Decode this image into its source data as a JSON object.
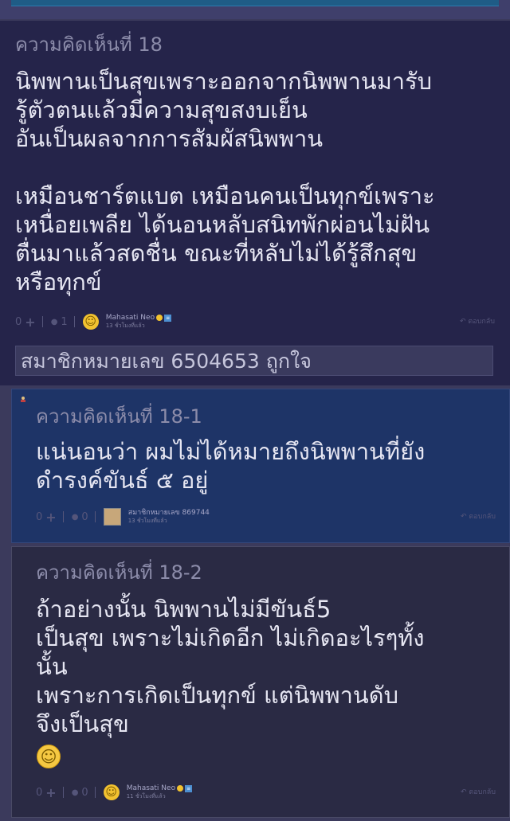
{
  "comments": [
    {
      "number": "ความคิดเห็นที่ 18",
      "text": "นิพพานเป็นสุขเพราะออกจากนิพพานมารับ\nรู้ตัวตนแล้วมีความสุขสงบเย็น\nอันเป็นผลจากการสัมผัสนิพพาน\n\nเหมือนชาร์ตแบต  เหมือนคนเป็นทุกข์เพราะ\nเหนื่อยเพลีย ได้นอนหลับสนิทพักผ่อนไม่ฝัน\nตื่นมาแล้วสดชื่น  ขณะที่หลับไม่ได้รู้สึกสุข\nหรือทุกข์",
      "vote_count": "0",
      "reply_count": "1",
      "author": "Mahasati Neo",
      "time": "13 ชั่วโมงที่แล้ว",
      "reply_label": "ตอบกลับ",
      "liked_by": "สมาชิกหมายเลข 6504653 ถูกใจ"
    },
    {
      "number": "ความคิดเห็นที่ 18-1",
      "text": "แน่นอนว่า ผมไม่ได้หมายถึงนิพพานที่ยัง\nดำรงค์ขันธ์ ๕ อยู่",
      "vote_count": "0",
      "reply_count": "0",
      "author": "สมาชิกหมายเลข 869744",
      "time": "13 ชั่วโมงที่แล้ว",
      "reply_label": "ตอบกลับ"
    },
    {
      "number": "ความคิดเห็นที่ 18-2",
      "text": "ถ้าอย่างนั้น นิพพานไม่มีขันธ์5\nเป็นสุข เพราะไม่เกิดอีก ไม่เกิดอะไรๆทั้ง\nนั้น\nเพราะการเกิดเป็นทุกข์ แต่นิพพานดับ\nจึงเป็นสุข",
      "emoji": "☺",
      "vote_count": "0",
      "reply_count": "0",
      "author": "Mahasati Neo",
      "time": "11 ชั่วโมงที่แล้ว",
      "reply_label": "ตอบกลับ"
    }
  ],
  "icons": {
    "plus": "+",
    "bubble": "●",
    "smile": "☺",
    "reply_arrow": "↶"
  },
  "colors": {
    "page_bg": "#3b3a5c",
    "comment_main_bg": "#25244a",
    "comment_highlight_bg": "#1e3467",
    "comment_sub_bg": "#2a2a44",
    "text": "#e6e6f2"
  }
}
